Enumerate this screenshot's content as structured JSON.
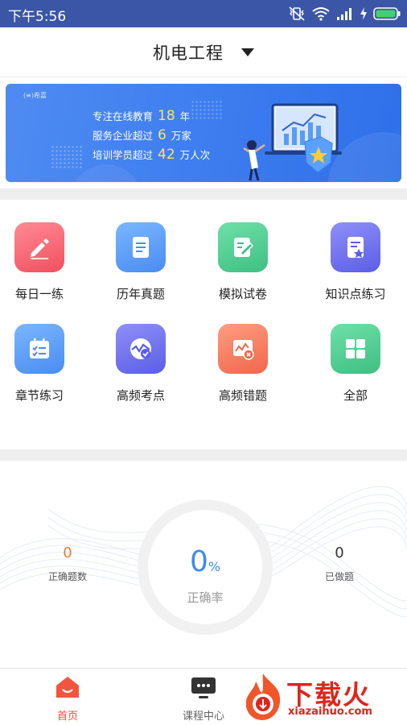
{
  "status_bar": {
    "time": "下午5:56"
  },
  "header": {
    "title": "机电工程"
  },
  "banner": {
    "brand": "(≡)希嘉",
    "line1_prefix": "专注在线教育",
    "line1_num": "18",
    "line1_suffix": "年",
    "line2_prefix": "服务企业超过",
    "line2_num": "6",
    "line2_suffix": "万家",
    "line3_prefix": "培训学员超过",
    "line3_num": "42",
    "line3_suffix": "万人次"
  },
  "grid": {
    "items": [
      {
        "label": "每日一练",
        "icon": "pencil-icon",
        "color": "#f4606c"
      },
      {
        "label": "历年真题",
        "icon": "document-icon",
        "color": "#5a9cf5"
      },
      {
        "label": "模拟试卷",
        "icon": "edit-paper-icon",
        "color": "#4fc98e"
      },
      {
        "label": "知识点练习",
        "icon": "badge-doc-icon",
        "color": "#6b6ff0"
      },
      {
        "label": "章节练习",
        "icon": "calendar-check-icon",
        "color": "#5a9cf5"
      },
      {
        "label": "高频考点",
        "icon": "chart-check-icon",
        "color": "#6b6ff0"
      },
      {
        "label": "高频错题",
        "icon": "error-chart-icon",
        "color": "#f47a5f"
      },
      {
        "label": "全部",
        "icon": "grid-icon",
        "color": "#4fc98e"
      }
    ]
  },
  "stats": {
    "correct_count": "0",
    "correct_count_label": "正确题数",
    "accuracy": "0",
    "accuracy_unit": "%",
    "accuracy_label": "正确率",
    "done_count": "0",
    "done_count_label": "已做题",
    "correct_color": "#f07a2c",
    "accent": "#3f8af2"
  },
  "tabbar": {
    "home": "首页",
    "courses": "课程中心",
    "active_color": "#e94f3c"
  },
  "watermark": {
    "text": "下载火",
    "url": "xiazaihuo.com"
  }
}
